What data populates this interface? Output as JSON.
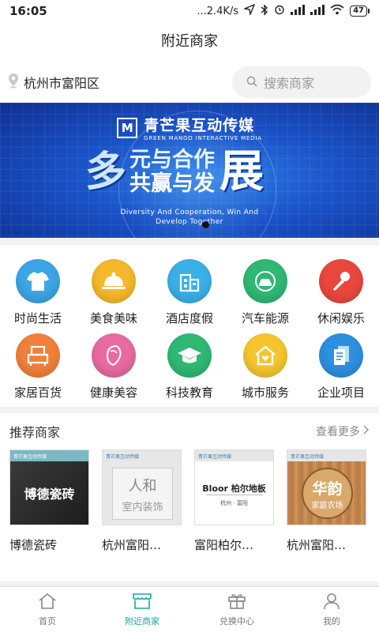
{
  "status_bar": {
    "time": "16:05",
    "network_speed": "...2.4K/s",
    "battery": "47"
  },
  "header": {
    "title": "附近商家"
  },
  "location": {
    "city": "杭州市富阳区",
    "icon": "location-pin-icon"
  },
  "search": {
    "placeholder": "搜索商家",
    "icon": "search-icon"
  },
  "banner": {
    "logo_cn": "青芒果互动传媒",
    "logo_en": "GREEN MANGO INTERACTIVE MEDIA",
    "headline_big_left": "多",
    "headline_line1": "元与合作",
    "headline_line2": "共赢与发",
    "headline_big_right": "展",
    "subtitle_line1": "Diversity And Cooperation, Win And",
    "subtitle_line2": "Develop Together",
    "active_slide": 1
  },
  "categories": [
    {
      "label": "时尚生活",
      "icon": "tshirt-icon",
      "color": "#3ca5e6"
    },
    {
      "label": "美食美味",
      "icon": "food-cloche-icon",
      "color": "#f5b82a"
    },
    {
      "label": "酒店度假",
      "icon": "hotel-building-icon",
      "color": "#3ab0e8"
    },
    {
      "label": "汽车能源",
      "icon": "car-icon",
      "color": "#2fb873"
    },
    {
      "label": "休闲娱乐",
      "icon": "microphone-icon",
      "color": "#e9473e"
    },
    {
      "label": "家居百货",
      "icon": "home-goods-icon",
      "color": "#f0803c"
    },
    {
      "label": "健康美容",
      "icon": "beauty-face-icon",
      "color": "#e86aa0"
    },
    {
      "label": "科技教育",
      "icon": "graduation-cap-icon",
      "color": "#2fb873"
    },
    {
      "label": "城市服务",
      "icon": "house-heart-icon",
      "color": "#f5c52e"
    },
    {
      "label": "企业项目",
      "icon": "documents-icon",
      "color": "#2d8fe0"
    }
  ],
  "recommend": {
    "title": "推荐商家",
    "more_label": "查看更多",
    "merchants": [
      {
        "name": "博德瓷砖",
        "image_text": "博德瓷砖",
        "brand_tag": "青芒果互动传媒"
      },
      {
        "name": "杭州富阳…",
        "image_text_line1": "人和",
        "image_text_line2": "室内装饰",
        "brand_tag": "青芒果互动传媒"
      },
      {
        "name": "富阳柏尔…",
        "image_text_line1": "Bloor 柏尔地板",
        "image_text_line2": "杭州 · 富阳",
        "brand_tag": "青芒果互动传媒"
      },
      {
        "name": "杭州富阳…",
        "image_text_line1": "华韵",
        "image_text_line2": "家庭农场",
        "brand_tag": "青芒果互动传媒"
      }
    ]
  },
  "tab_bar": {
    "tabs": [
      {
        "label": "首页",
        "icon": "home-icon"
      },
      {
        "label": "附近商家",
        "icon": "store-icon"
      },
      {
        "label": "兑换中心",
        "icon": "gift-box-icon"
      },
      {
        "label": "我的",
        "icon": "user-icon"
      }
    ],
    "active_index": 1,
    "active_color": "#1aa89a"
  }
}
